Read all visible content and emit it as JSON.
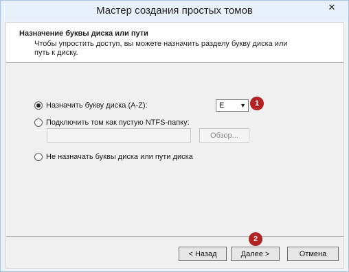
{
  "window": {
    "title": "Мастер создания простых томов",
    "close_glyph": "✕"
  },
  "header": {
    "title": "Назначение буквы диска или пути",
    "description": "Чтобы упростить доступ, вы можете назначить разделу букву диска или путь к диску."
  },
  "options": {
    "assign_letter": {
      "label": "Назначить букву диска (A-Z):",
      "selected": true
    },
    "mount_folder": {
      "label": "Подключить том как пустую NTFS-папку:",
      "selected": false
    },
    "no_letter": {
      "label": "Не назначать буквы диска или пути диска",
      "selected": false
    }
  },
  "drive_select": {
    "value": "E",
    "chevron": "⌄"
  },
  "folder_path": {
    "value": ""
  },
  "browse_button": {
    "label": "Обзор..."
  },
  "annotations": {
    "badge1": "1",
    "badge2": "2",
    "color": "#b22323"
  },
  "footer": {
    "back_label": "< Назад",
    "next_label": "Далее >",
    "cancel_label": "Отмена"
  }
}
